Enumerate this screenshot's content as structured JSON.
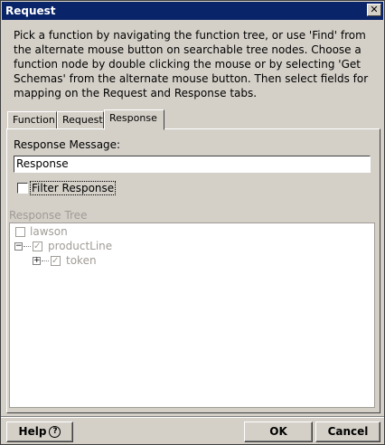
{
  "window": {
    "title": "Request",
    "close_glyph": "✕"
  },
  "instructions": "Pick a function by navigating the function tree, or use 'Find' from the alternate mouse button on searchable tree nodes. Choose a function node by double clicking the mouse or by selecting 'Get Schemas' from the alternate mouse button. Then select fields for mapping on the Request and Response tabs.",
  "tabs": [
    {
      "label": "Function",
      "active": false
    },
    {
      "label": "Request",
      "active": false
    },
    {
      "label": "Response",
      "active": true
    }
  ],
  "response": {
    "message_label": "Response Message:",
    "message_value": "Response",
    "filter_label": "Filter Response",
    "filter_checked": false
  },
  "tree": {
    "label": "Response Tree",
    "nodes": [
      {
        "label": "lawson",
        "checked": false,
        "expander": ""
      },
      {
        "label": "productLine",
        "checked": true,
        "expander": "−"
      },
      {
        "label": "token",
        "checked": true,
        "expander": "+"
      }
    ]
  },
  "buttons": {
    "help": "Help",
    "help_glyph": "?",
    "ok": "OK",
    "cancel": "Cancel"
  }
}
